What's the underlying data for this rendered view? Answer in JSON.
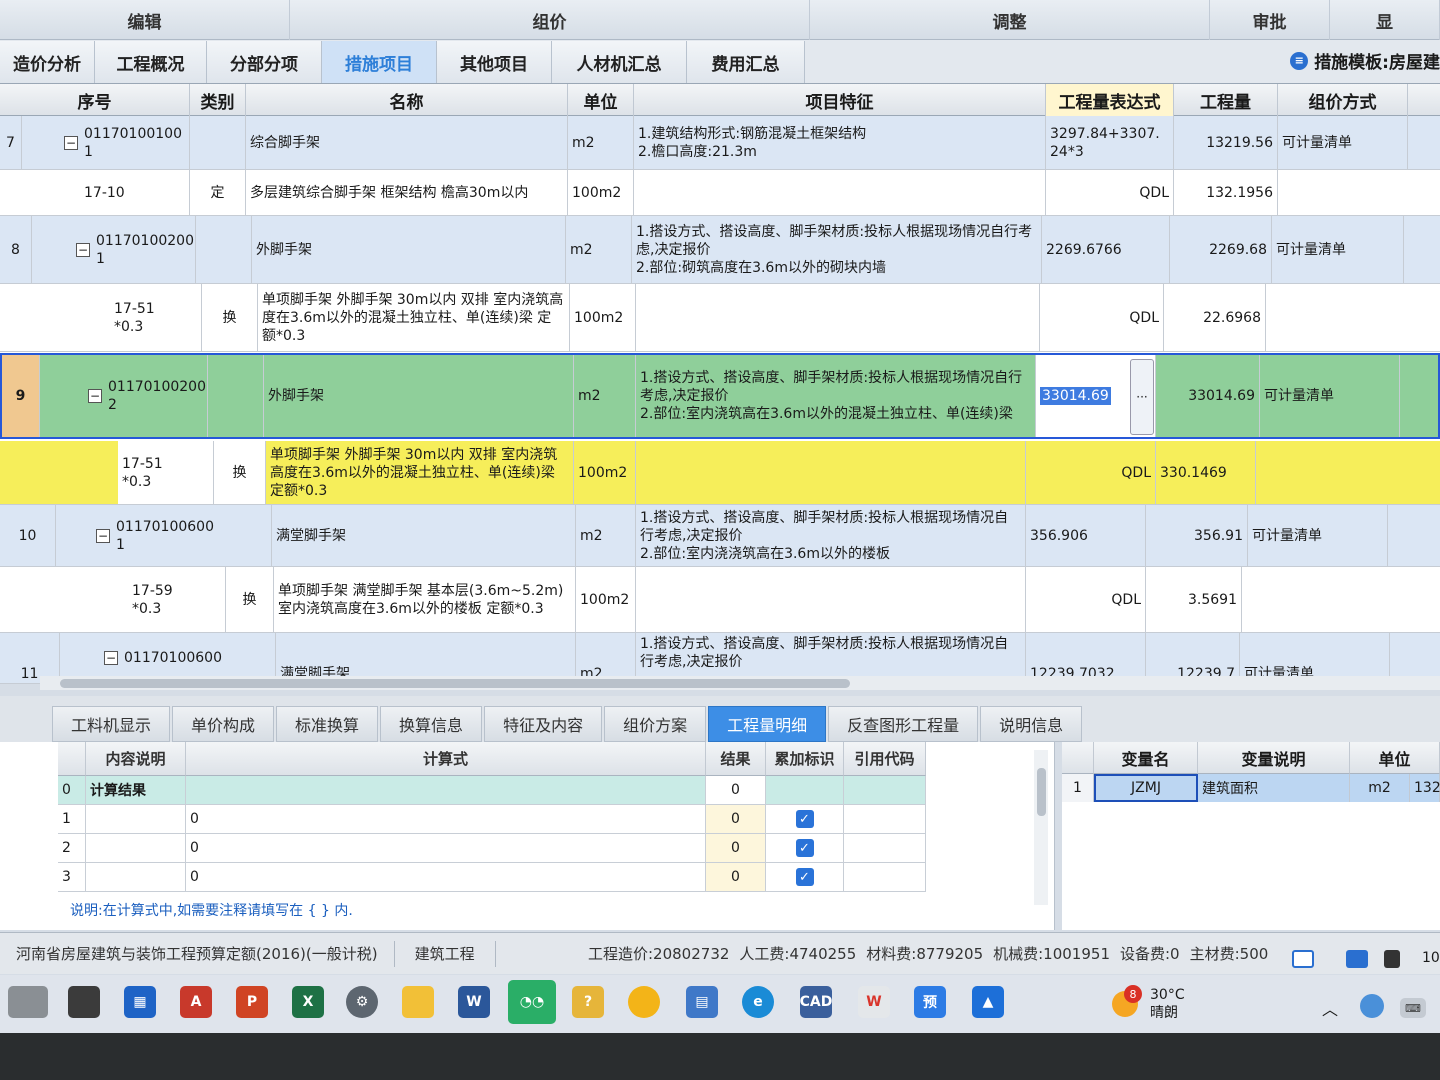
{
  "menu": [
    "编辑",
    "组价",
    "调整",
    "审批",
    "显"
  ],
  "tabs": [
    "造价分析",
    "工程概况",
    "分部分项",
    "措施项目",
    "其他项目",
    "人材机汇总",
    "费用汇总"
  ],
  "active_tab": "措施项目",
  "template_label": "措施模板:房屋建",
  "grid": {
    "headers": [
      "序号",
      "类别",
      "名称",
      "单位",
      "项目特征",
      "工程量表达式",
      "工程量",
      "组价方式"
    ],
    "rows": [
      {
        "num": "7",
        "code": "01170100100\n1",
        "type": "",
        "name": "综合脚手架",
        "unit": "m2",
        "feature": "1.建筑结构形式:钢筋混凝土框架结构\n2.檐口高度:21.3m",
        "expr": "3297.84+3307.\n24*3",
        "qty": "13219.56",
        "method": "可计量清单"
      },
      {
        "num": "",
        "code": "17-10",
        "type": "定",
        "name": "多层建筑综合脚手架 框架结构 檐高30m以内",
        "unit": "100m2",
        "feature": "",
        "expr": "QDL",
        "qty": "132.1956",
        "method": ""
      },
      {
        "num": "8",
        "code": "01170100200\n1",
        "type": "",
        "name": "外脚手架",
        "unit": "m2",
        "feature": "1.搭设方式、搭设高度、脚手架材质:投标人根据现场情况自行考虑,决定报价\n2.部位:砌筑高度在3.6m以外的砌块内墙",
        "expr": "2269.6766",
        "qty": "2269.68",
        "method": "可计量清单"
      },
      {
        "num": "",
        "code": "17-51\n*0.3",
        "type": "换",
        "name": "单项脚手架 外脚手架 30m以内 双排 室内浇筑高度在3.6m以外的混凝土独立柱、单(连续)梁 定额*0.3",
        "unit": "100m2",
        "feature": "",
        "expr": "QDL",
        "qty": "22.6968",
        "method": ""
      },
      {
        "num": "9",
        "code": "01170100200\n2",
        "type": "",
        "name": "外脚手架",
        "unit": "m2",
        "feature": "1.搭设方式、搭设高度、脚手架材质:投标人根据现场情况自行考虑,决定报价\n2.部位:室内浇筑高在3.6m以外的混凝土独立柱、单(连续)梁",
        "expr": "33014.69",
        "qty": "33014.69",
        "method": "可计量清单"
      },
      {
        "num": "",
        "code": "17-51\n*0.3",
        "type": "换",
        "name": "单项脚手架 外脚手架 30m以内 双排 室内浇筑高度在3.6m以外的混凝土独立柱、单(连续)梁 定额*0.3",
        "unit": "100m2",
        "feature": "",
        "expr": "QDL",
        "qty": "330.1469",
        "method": ""
      },
      {
        "num": "10",
        "code": "01170100600\n1",
        "type": "",
        "name": "满堂脚手架",
        "unit": "m2",
        "feature": "1.搭设方式、搭设高度、脚手架材质:投标人根据现场情况自行考虑,决定报价\n2.部位:室内浇浇筑高在3.6m以外的楼板",
        "expr": "356.906",
        "qty": "356.91",
        "method": "可计量清单"
      },
      {
        "num": "",
        "code": "17-59\n*0.3",
        "type": "换",
        "name": "单项脚手架 满堂脚手架 基本层(3.6m~5.2m) 室内浇筑高度在3.6m以外的楼板 定额*0.3",
        "unit": "100m2",
        "feature": "",
        "expr": "QDL",
        "qty": "3.5691",
        "method": ""
      },
      {
        "num": "11",
        "code": "01170100600",
        "type": "",
        "name": "满堂脚手架",
        "unit": "m2",
        "feature": "1.搭设方式、搭设高度、脚手架材质:投标人根据现场情况自行考虑,决定报价",
        "expr": "12239.7032",
        "qty": "12239.7",
        "method": "可计量清单"
      }
    ],
    "edit_button": "···"
  },
  "bottom_tabs": [
    "工料机显示",
    "单价构成",
    "标准换算",
    "换算信息",
    "特征及内容",
    "组价方案",
    "工程量明细",
    "反查图形工程量",
    "说明信息"
  ],
  "active_bottom_tab": "工程量明细",
  "calc_table": {
    "headers": [
      "内容说明",
      "计算式",
      "结果",
      "累加标识",
      "引用代码"
    ],
    "rows": [
      {
        "idx": "0",
        "desc": "计算结果",
        "formula": "",
        "result": "0",
        "checked": false
      },
      {
        "idx": "1",
        "desc": "",
        "formula": "0",
        "result": "0",
        "checked": true
      },
      {
        "idx": "2",
        "desc": "",
        "formula": "0",
        "result": "0",
        "checked": true
      },
      {
        "idx": "3",
        "desc": "",
        "formula": "0",
        "result": "0",
        "checked": true
      }
    ],
    "note": "说明:在计算式中,如需要注释请填写在 { } 内."
  },
  "var_table": {
    "headers": [
      "变量名",
      "变量说明",
      "单位"
    ],
    "row": {
      "idx": "1",
      "name": "JZMJ",
      "desc": "建筑面积",
      "unit": "m2",
      "value": "132"
    }
  },
  "status": {
    "quota": "河南省房屋建筑与装饰工程预算定额(2016)(一般计税)",
    "project": "建筑工程",
    "costs": [
      "工程造价:20802732",
      "人工费:4740255",
      "材料费:8779205",
      "机械费:1001951",
      "设备费:0",
      "主材费:500"
    ],
    "zoom": "10"
  },
  "taskbar": {
    "weather_temp": "30°C",
    "weather_desc": "晴朗",
    "badge": "8"
  }
}
